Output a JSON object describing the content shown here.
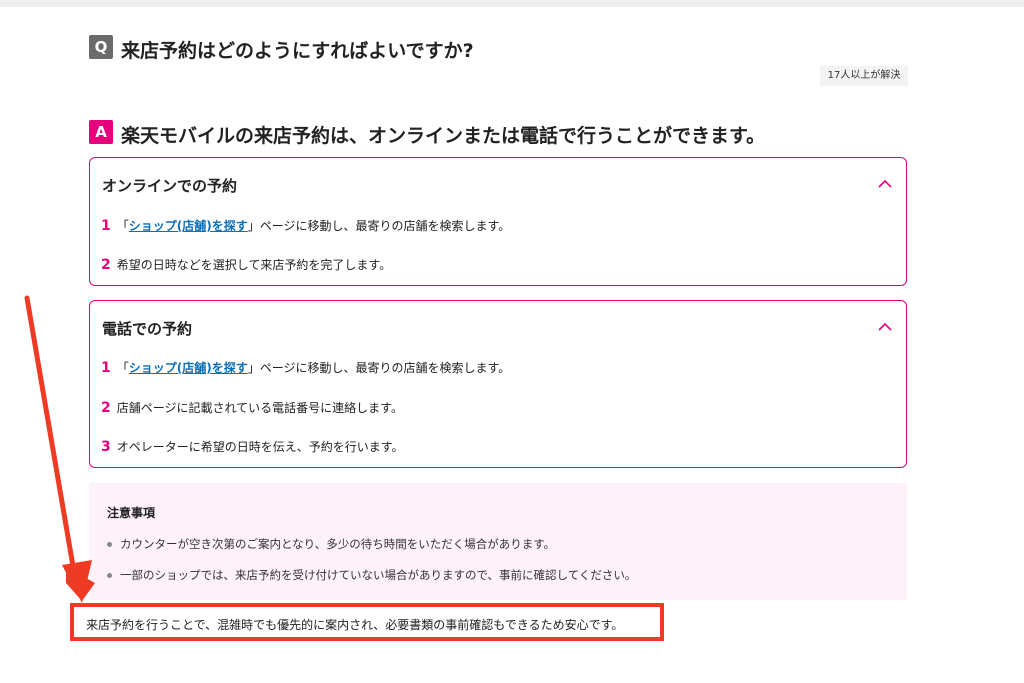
{
  "question": {
    "badge": "Q",
    "text": "来店予約はどのようにすればよいですか?"
  },
  "resolved_badge": "17人以上が解決",
  "answer": {
    "badge": "A",
    "text": "楽天モバイルの来店予約は、オンラインまたは電話で行うことができます。"
  },
  "online": {
    "title": "オンラインでの予約",
    "steps": [
      {
        "num": "1",
        "pre": "「",
        "link": "ショップ(店舗)を探す",
        "post": "」ページに移動し、最寄りの店舗を検索します。"
      },
      {
        "num": "2",
        "text": "希望の日時などを選択して来店予約を完了します。"
      }
    ]
  },
  "phone": {
    "title": "電話での予約",
    "steps": [
      {
        "num": "1",
        "pre": "「",
        "link": "ショップ(店舗)を探す",
        "post": "」ページに移動し、最寄りの店舗を検索します。"
      },
      {
        "num": "2",
        "text": "店舗ページに記載されている電話番号に連絡します。"
      },
      {
        "num": "3",
        "text": "オペレーターに希望の日時を伝え、予約を行います。"
      }
    ]
  },
  "notes": {
    "title": "注意事項",
    "items": [
      "カウンターが空き次第のご案内となり、多少の待ち時間をいただく場合があります。",
      "一部のショップでは、来店予約を受け付けていない場合がありますので、事前に確認してください。"
    ]
  },
  "highlight": "来店予約を行うことで、混雑時でも優先的に案内され、必要書類の事前確認もできるため安心です。",
  "colors": {
    "accent": "#e6007e",
    "link": "#0f6fb5",
    "annotation": "#ef3b24",
    "notes_bg": "#fdf1fa"
  },
  "icons": {
    "collapse": "chevron-up-icon",
    "annotation": "arrow-icon"
  }
}
